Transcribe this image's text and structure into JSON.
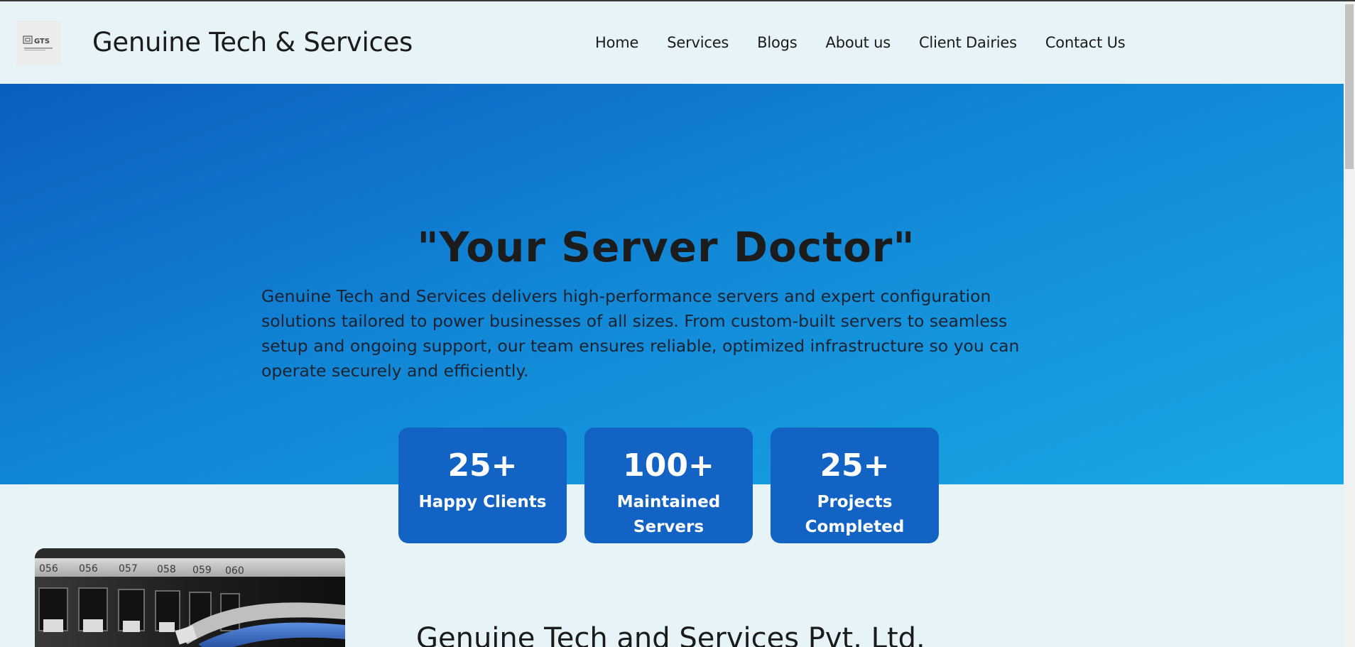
{
  "header": {
    "logo_text": "GTS",
    "brand": "Genuine Tech & Services",
    "nav": [
      {
        "label": "Home"
      },
      {
        "label": "Services"
      },
      {
        "label": "Blogs"
      },
      {
        "label": "About us"
      },
      {
        "label": "Client Dairies"
      },
      {
        "label": "Contact Us"
      }
    ]
  },
  "hero": {
    "title": "\"Your Server Doctor\"",
    "description": "Genuine Tech and Services delivers high-performance servers and expert configuration solutions tailored to power businesses of all sizes. From custom-built servers to seamless setup and ongoing support, our team ensures reliable, optimized infrastructure so you can operate securely and efficiently."
  },
  "stats": [
    {
      "value": "25+",
      "label": "Happy Clients"
    },
    {
      "value": "100+",
      "label": "Maintained Servers"
    },
    {
      "value": "25+",
      "label": "Projects Completed"
    }
  ],
  "about": {
    "image_icon": "network-patch-panel-photo",
    "heading": "Genuine Tech and Services Pvt. Ltd."
  },
  "colors": {
    "page_bg": "#e6f3f7",
    "hero_gradient_start": "#0b5fbd",
    "hero_gradient_end": "#18a9e6",
    "stat_card_bg": "#1363c4"
  }
}
